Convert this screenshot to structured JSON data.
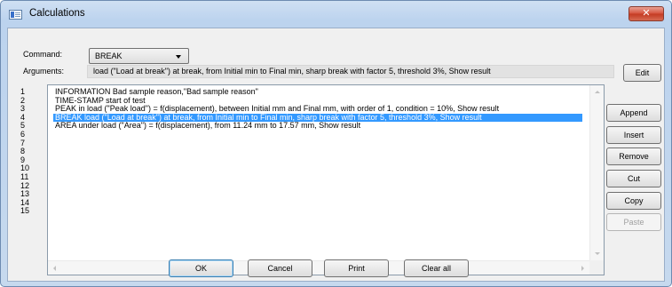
{
  "window": {
    "title": "Calculations",
    "close_glyph": "✕"
  },
  "command": {
    "label": "Command:",
    "value": "BREAK"
  },
  "arguments": {
    "label": "Arguments:",
    "value": "load (\"Load at break\") at break, from Initial min to Final min, sharp break with factor 5, threshold 3%, Show result"
  },
  "edit_label": "Edit",
  "line_numbers": [
    "1",
    "2",
    "3",
    "4",
    "5",
    "6",
    "7",
    "8",
    "9",
    "10",
    "11",
    "12",
    "13",
    "14",
    "15"
  ],
  "list": {
    "selected_index": 3,
    "rows": [
      "INFORMATION Bad sample reason,\"Bad sample reason\"",
      "TIME-STAMP start of test",
      "PEAK in load (\"Peak load\") = f(displacement), between Initial mm and Final mm, with order of 1, condition = 10%, Show result",
      "BREAK load (\"Load at break\") at break, from Initial min to Final min, sharp break with factor 5, threshold 3%, Show result",
      "AREA under load (\"Area\") = f(displacement), from 11.24 mm to 17.57 mm, Show result"
    ]
  },
  "side_buttons": {
    "append": "Append",
    "insert": "Insert",
    "remove": "Remove",
    "cut": "Cut",
    "copy": "Copy",
    "paste": "Paste"
  },
  "bottom_buttons": {
    "ok": "OK",
    "cancel": "Cancel",
    "print": "Print",
    "clear_all": "Clear all"
  },
  "colors": {
    "selection": "#3399ff",
    "close_button": "#c9452e"
  }
}
